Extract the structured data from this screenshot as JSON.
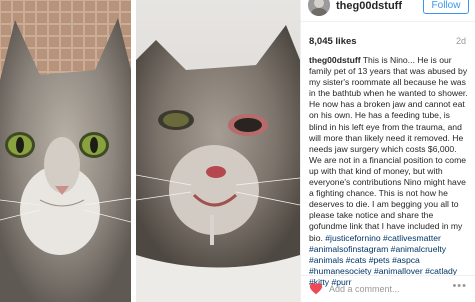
{
  "post": {
    "username": "theg00dstuff",
    "follow_label": "Follow",
    "likes": "8,045 likes",
    "age": "2d",
    "caption_text": "This is Nino... He is our family pet of 13 years that was abused by my sister's roommate all because he was in the bathtub when he wanted to shower. He now has a broken jaw and cannot eat on his own. He has a feeding tube, is blind in his left eye from the trauma, and will more than likely need it removed. He needs jaw surgery which costs $6,000. We are not in a financial position to come up with that kind of money, but with everyone's contributions Nino might have a fighting chance. This is not how he deserves to die. I am begging you all to please take notice and share the gofundme link that I have included in my bio.",
    "hashtags": "#justicefornino #catlivesmatter #animalsofinstagram #animalcruelty #animals #cats #pets #aspca #humanesociety #animallover #catlady #kitty #purr",
    "comment_placeholder": "Add a comment...",
    "more_label": "•••"
  },
  "colors": {
    "accent": "#3897f0",
    "like_red": "#ed4956",
    "hashtag": "#003569"
  },
  "icons": [
    "heart-icon",
    "more-options-icon"
  ]
}
